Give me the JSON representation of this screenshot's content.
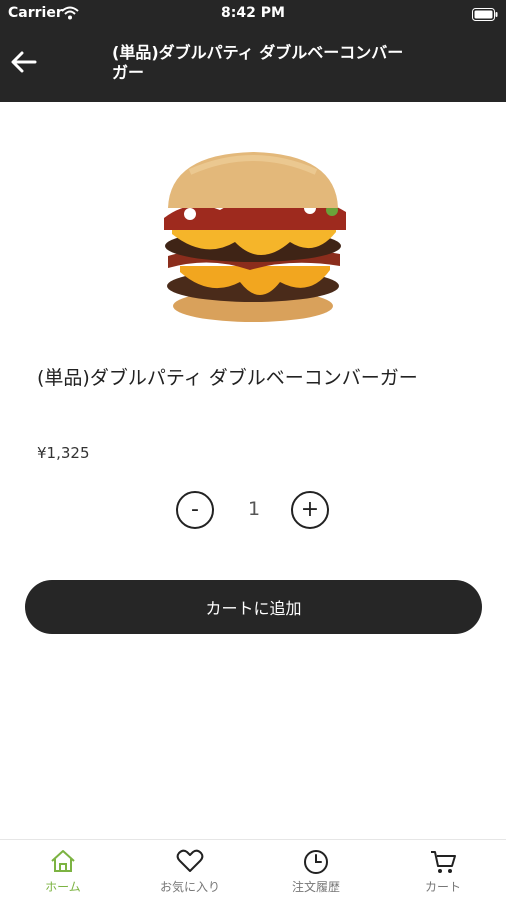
{
  "status_bar": {
    "carrier": "Carrier",
    "time": "8:42 PM"
  },
  "header": {
    "title": "(単品)ダブルパティ ダブルベーコンバーガー"
  },
  "product": {
    "name": "(単品)ダブルパティ ダブルベーコンバーガー",
    "price": "¥1,325",
    "quantity": "1",
    "minus_label": "-",
    "plus_label": "+",
    "add_to_cart_label": "カートに追加"
  },
  "tabs": [
    {
      "label": "ホーム",
      "icon": "home-icon",
      "active": true
    },
    {
      "label": "お気に入り",
      "icon": "heart-icon",
      "active": false
    },
    {
      "label": "注文履歴",
      "icon": "clock-icon",
      "active": false
    },
    {
      "label": "カート",
      "icon": "cart-icon",
      "active": false
    }
  ],
  "colors": {
    "header_bg": "#262626",
    "active_tab": "#7cb342",
    "button_bg": "#262626"
  }
}
